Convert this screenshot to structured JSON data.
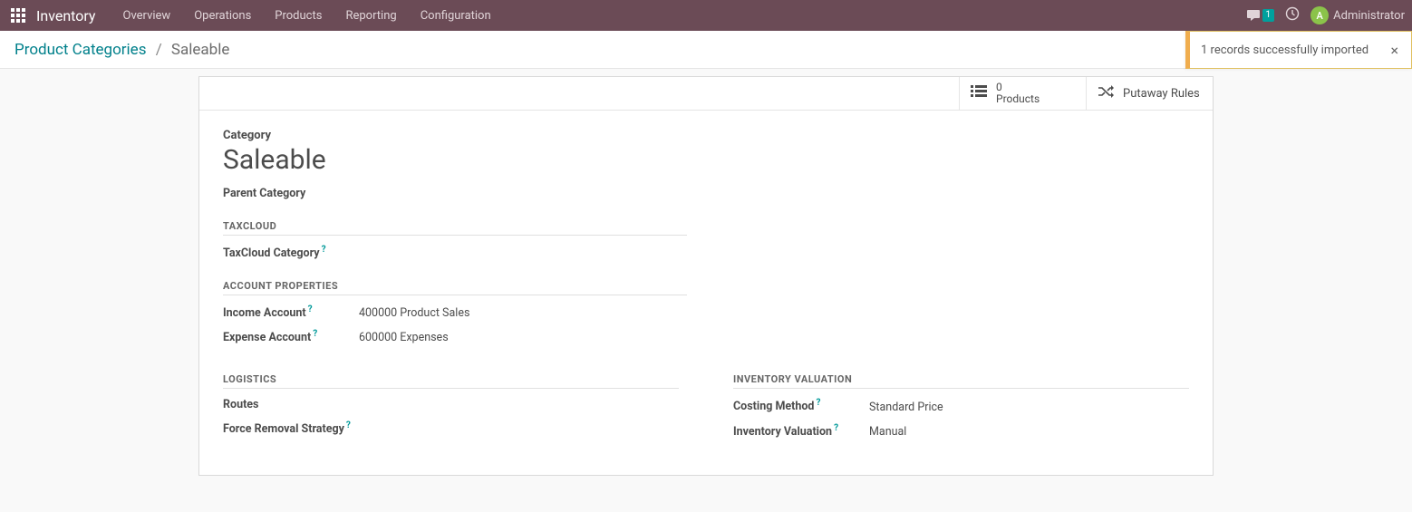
{
  "app": {
    "title": "Inventory"
  },
  "nav": {
    "items": [
      "Overview",
      "Operations",
      "Products",
      "Reporting",
      "Configuration"
    ]
  },
  "systray": {
    "msg_count": "1",
    "user_initial": "A",
    "user_name": "Administrator"
  },
  "breadcrumb": {
    "parent": "Product Categories",
    "current": "Saleable"
  },
  "toast": {
    "text": "1 records successfully imported"
  },
  "stat_buttons": {
    "products": {
      "count": "0",
      "label": "Products"
    },
    "putaway": {
      "label": "Putaway Rules"
    }
  },
  "form": {
    "category_label": "Category",
    "name": "Saleable",
    "parent_category_label": "Parent Category",
    "parent_category_value": "",
    "sections": {
      "taxcloud": {
        "title": "TAXCLOUD",
        "taxcloud_category_label": "TaxCloud Category",
        "taxcloud_category_value": ""
      },
      "account": {
        "title": "ACCOUNT PROPERTIES",
        "income_label": "Income Account",
        "income_value": "400000 Product Sales",
        "expense_label": "Expense Account",
        "expense_value": "600000 Expenses"
      },
      "logistics": {
        "title": "LOGISTICS",
        "routes_label": "Routes",
        "routes_value": "",
        "removal_label": "Force Removal Strategy",
        "removal_value": ""
      },
      "valuation": {
        "title": "INVENTORY VALUATION",
        "costing_label": "Costing Method",
        "costing_value": "Standard Price",
        "inv_val_label": "Inventory Valuation",
        "inv_val_value": "Manual"
      }
    }
  }
}
